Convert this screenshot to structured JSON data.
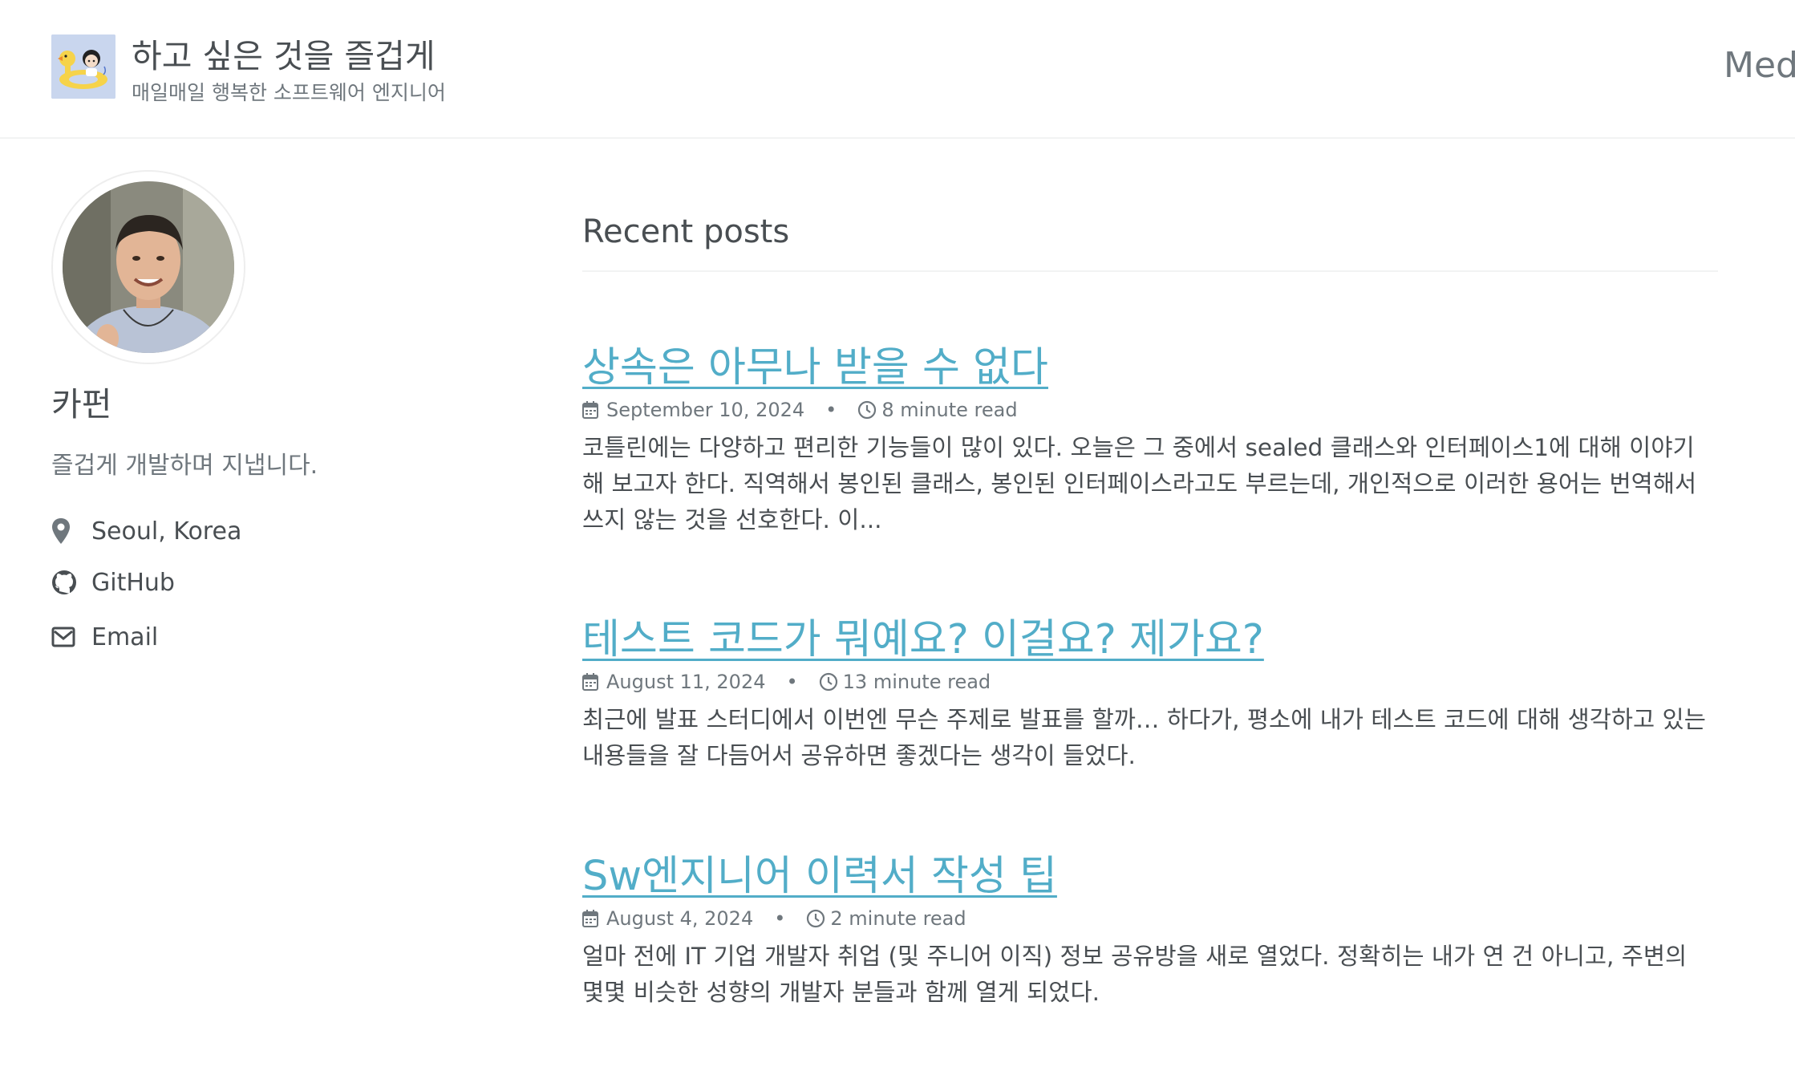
{
  "masthead": {
    "site_title": "하고 싶은 것을 즐겁게",
    "site_subtitle": "매일매일 행복한 소프트웨어 엔지니어",
    "nav_link": "Medi"
  },
  "author": {
    "name": "카펀",
    "bio": "즐겁게 개발하며 지냅니다.",
    "links": [
      {
        "label": "Seoul, Korea",
        "icon": "map-marker-icon"
      },
      {
        "label": "GitHub",
        "icon": "github-icon"
      },
      {
        "label": "Email",
        "icon": "envelope-icon"
      }
    ]
  },
  "main": {
    "page_title": "Recent posts",
    "posts": [
      {
        "title": "상속은 아무나 받을 수 없다",
        "date": "September 10, 2024",
        "read_time": "8 minute read",
        "excerpt": "코틀린에는 다양하고 편리한 기능들이 많이 있다. 오늘은 그 중에서 sealed 클래스와 인터페이스1에 대해 이야기 해 보고자 한다. 직역해서 봉인된 클래스, 봉인된 인터페이스라고도 부르는데, 개인적으로 이러한 용어는 번역해서 쓰지 않는 것을 선호한다. 이..."
      },
      {
        "title": "테스트 코드가 뭐예요? 이걸요? 제가요?",
        "date": "August 11, 2024",
        "read_time": "13 minute read",
        "excerpt": "최근에 발표 스터디에서 이번엔 무슨 주제로 발표를 할까… 하다가, 평소에 내가 테스트 코드에 대해 생각하고 있는 내용들을 잘 다듬어서 공유하면 좋겠다는 생각이 들었다."
      },
      {
        "title": "Sw엔지니어 이력서 작성 팁",
        "date": "August 4, 2024",
        "read_time": "2 minute read",
        "excerpt": "얼마 전에 IT 기업 개발자 취업 (및 주니어 이직) 정보 공유방을 새로 열었다. 정확히는 내가 연 건 아니고, 주변의 몇몇 비슷한 성향의 개발자 분들과 함께 열게 되었다."
      }
    ],
    "meta_separator": "•"
  },
  "colors": {
    "link": "#52adc8",
    "text": "#494e52",
    "muted": "#6f777d",
    "rule": "#f2f3f3"
  }
}
